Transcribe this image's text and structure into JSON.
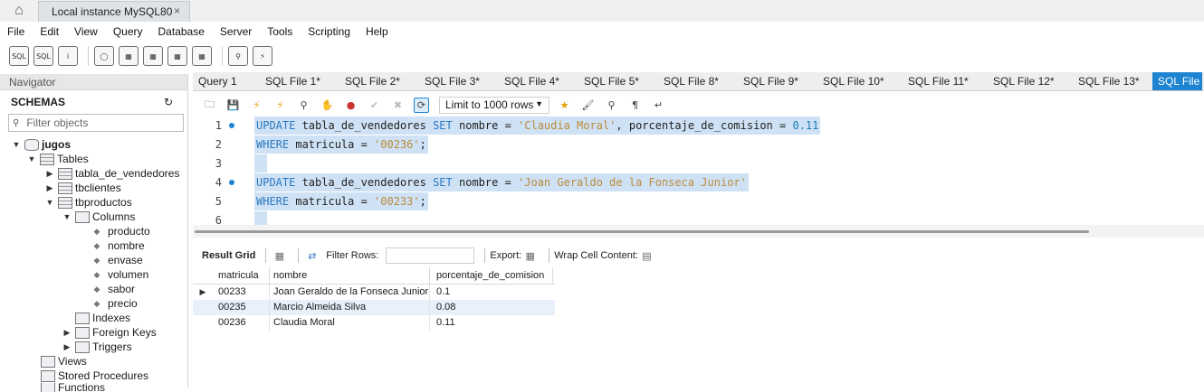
{
  "window": {
    "connection_tab": "Local instance MySQL80",
    "close_glyph": "×"
  },
  "menu": [
    "File",
    "Edit",
    "View",
    "Query",
    "Database",
    "Server",
    "Tools",
    "Scripting",
    "Help"
  ],
  "navigator": {
    "header": "Navigator",
    "schemas_title": "SCHEMAS",
    "filter_placeholder": "Filter objects",
    "tree": {
      "schema": "jugos",
      "tables_label": "Tables",
      "tables": [
        "tabla_de_vendedores",
        "tbclientes",
        "tbproductos"
      ],
      "columns_label": "Columns",
      "columns": [
        "producto",
        "nombre",
        "envase",
        "volumen",
        "sabor",
        "precio"
      ],
      "indexes_label": "Indexes",
      "foreign_keys_label": "Foreign Keys",
      "triggers_label": "Triggers",
      "views_label": "Views",
      "procedures_label": "Stored Procedures",
      "functions_label": "Functions"
    }
  },
  "sql_tabs": [
    "Query 1",
    "SQL File 1*",
    "SQL File 2*",
    "SQL File 3*",
    "SQL File 4*",
    "SQL File 5*",
    "SQL File 8*",
    "SQL File 9*",
    "SQL File 10*",
    "SQL File 11*",
    "SQL File 12*",
    "SQL File 13*",
    "SQL File"
  ],
  "editor_toolbar": {
    "limit_label": "Limit to 1000 rows"
  },
  "editor": {
    "line_numbers": [
      "1",
      "2",
      "3",
      "4",
      "5",
      "6"
    ],
    "line1": {
      "kw1": "UPDATE",
      "t1": " tabla_de_vendedores ",
      "kw2": "SET",
      "t2": " nombre = ",
      "s1": "'Claudia Moral'",
      "t3": ", porcentaje_de_comision = ",
      "n1": "0.11"
    },
    "line2": {
      "kw1": "WHERE",
      "t1": " matricula = ",
      "s1": "'00236'",
      "t2": ";"
    },
    "line4": {
      "kw1": "UPDATE",
      "t1": " tabla_de_vendedores ",
      "kw2": "SET",
      "t2": " nombre = ",
      "s1": "'Joan Geraldo de la Fonseca Junior'"
    },
    "line5": {
      "kw1": "WHERE",
      "t1": " matricula = ",
      "s1": "'00233'",
      "t2": ";"
    }
  },
  "result_toolbar": {
    "result_grid": "Result Grid",
    "filter_rows": "Filter Rows:",
    "export": "Export:",
    "wrap": "Wrap Cell Content:"
  },
  "result_grid": {
    "columns": [
      "matricula",
      "nombre",
      "porcentaje_de_comision"
    ],
    "rows": [
      [
        "00233",
        "Joan Geraldo de la Fonseca Junior",
        "0.1"
      ],
      [
        "00235",
        "Marcio Almeida Silva",
        "0.08"
      ],
      [
        "00236",
        "Claudia Moral",
        "0.11"
      ]
    ]
  },
  "colors": {
    "accent": "#1e84d2",
    "keyword": "#2b79c2",
    "string": "#bb8a3a",
    "selection": "#cfe2f5"
  }
}
